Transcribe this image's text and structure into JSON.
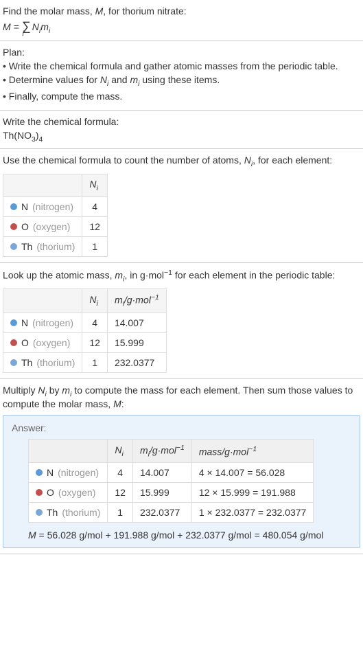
{
  "intro": {
    "line1_prefix": "Find the molar mass, ",
    "line1_var": "M",
    "line1_suffix": ", for thorium nitrate:",
    "formula_lhs": "M",
    "formula_eq": " = ",
    "formula_sum": "∑",
    "formula_idx": "i",
    "formula_rhs1": "N",
    "formula_rhs1_sub": "i",
    "formula_rhs2": "m",
    "formula_rhs2_sub": "i"
  },
  "plan": {
    "title": "Plan:",
    "item1_prefix": "• Write the chemical formula and gather atomic masses from the periodic table.",
    "item2_prefix": "• Determine values for ",
    "item2_n": "N",
    "item2_ni": "i",
    "item2_and": " and ",
    "item2_m": "m",
    "item2_mi": "i",
    "item2_suffix": " using these items.",
    "item3": "• Finally, compute the mass."
  },
  "step1": {
    "title": "Write the chemical formula:",
    "formula_th": "Th(NO",
    "formula_3": "3",
    "formula_close": ")",
    "formula_4": "4"
  },
  "step2": {
    "title_prefix": "Use the chemical formula to count the number of atoms, ",
    "title_n": "N",
    "title_ni": "i",
    "title_suffix": ", for each element:",
    "header_n": "N",
    "header_ni": "i",
    "rows": [
      {
        "dot": "dot-blue",
        "sym": "N",
        "name": " (nitrogen)",
        "n": "4"
      },
      {
        "dot": "dot-red",
        "sym": "O",
        "name": " (oxygen)",
        "n": "12"
      },
      {
        "dot": "dot-lightblue",
        "sym": "Th",
        "name": " (thorium)",
        "n": "1"
      }
    ]
  },
  "step3": {
    "title_prefix": "Look up the atomic mass, ",
    "title_m": "m",
    "title_mi": "i",
    "title_mid": ", in g·mol",
    "title_exp": "−1",
    "title_suffix": " for each element in the periodic table:",
    "header_n": "N",
    "header_ni": "i",
    "header_m": "m",
    "header_mi": "i",
    "header_unit": "/g·mol",
    "header_exp": "−1",
    "rows": [
      {
        "dot": "dot-blue",
        "sym": "N",
        "name": " (nitrogen)",
        "n": "4",
        "m": "14.007"
      },
      {
        "dot": "dot-red",
        "sym": "O",
        "name": " (oxygen)",
        "n": "12",
        "m": "15.999"
      },
      {
        "dot": "dot-lightblue",
        "sym": "Th",
        "name": " (thorium)",
        "n": "1",
        "m": "232.0377"
      }
    ]
  },
  "step4": {
    "title_prefix": "Multiply ",
    "title_n": "N",
    "title_ni": "i",
    "title_by": " by ",
    "title_m": "m",
    "title_mi": "i",
    "title_mid": " to compute the mass for each element. Then sum those values to compute the molar mass, ",
    "title_M": "M",
    "title_suffix": ":"
  },
  "answer": {
    "label": "Answer:",
    "header_n": "N",
    "header_ni": "i",
    "header_m": "m",
    "header_mi": "i",
    "header_munit": "/g·mol",
    "header_mexp": "−1",
    "header_mass": "mass/g·mol",
    "header_massexp": "−1",
    "rows": [
      {
        "dot": "dot-blue",
        "sym": "N",
        "name": " (nitrogen)",
        "n": "4",
        "m": "14.007",
        "calc": "4 × 14.007 = 56.028"
      },
      {
        "dot": "dot-red",
        "sym": "O",
        "name": " (oxygen)",
        "n": "12",
        "m": "15.999",
        "calc": "12 × 15.999 = 191.988"
      },
      {
        "dot": "dot-lightblue",
        "sym": "Th",
        "name": " (thorium)",
        "n": "1",
        "m": "232.0377",
        "calc": "1 × 232.0377 = 232.0377"
      }
    ],
    "final_M": "M",
    "final_eq": " = 56.028 g/mol + 191.988 g/mol + 232.0377 g/mol = 480.054 g/mol"
  }
}
